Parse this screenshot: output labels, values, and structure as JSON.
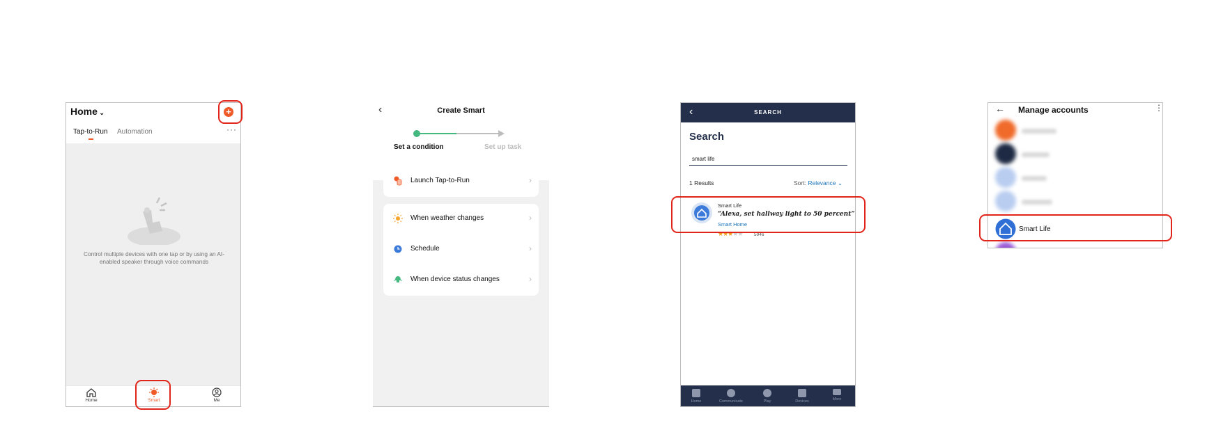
{
  "screen1": {
    "home_title": "Home",
    "add_icon": "plus-circle-icon",
    "tabs": [
      {
        "label": "Tap-to-Run"
      },
      {
        "label": "Automation"
      }
    ],
    "more": "···",
    "empty_message": "Control multiple devices with one tap or by using an AI-enabled speaker through voice commands",
    "nav": [
      {
        "label": "Home"
      },
      {
        "label": "Smart"
      },
      {
        "label": "Me"
      }
    ],
    "accent": "#f05a28"
  },
  "screen2": {
    "title": "Create Smart",
    "steps": [
      {
        "label": "Set a condition"
      },
      {
        "label": "Set up task"
      }
    ],
    "options": [
      {
        "label": "Launch Tap-to-Run",
        "icon": "hand-tap-icon"
      },
      {
        "label": "When weather changes",
        "icon": "sun-icon"
      },
      {
        "label": "Schedule",
        "icon": "clock-icon"
      },
      {
        "label": "When device status changes",
        "icon": "device-icon"
      }
    ],
    "step_color": "#43b97f"
  },
  "screen3": {
    "bar_title": "SEARCH",
    "heading": "Search",
    "query": "smart life",
    "results": "1 Results",
    "sort_label": "Sort:",
    "sort_value": "Relevance",
    "skill": {
      "name": "Smart Life",
      "quote": "“Alexa, set hallway light to 50 percent”",
      "category": "Smart Home",
      "rating": 3,
      "rating_max": 5,
      "rating_count": "5946"
    },
    "nav": [
      {
        "label": "Home"
      },
      {
        "label": "Communicate"
      },
      {
        "label": "Play"
      },
      {
        "label": "Devices"
      },
      {
        "label": "More"
      }
    ],
    "navy": "#232f4b"
  },
  "screen4": {
    "title": "Manage accounts",
    "selected_account": "Smart Life"
  }
}
